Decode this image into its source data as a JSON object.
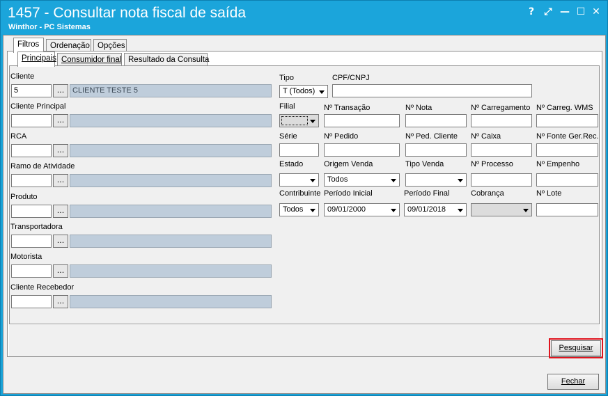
{
  "window": {
    "title": "1457 - Consultar nota fiscal de saída",
    "subtitle": "Winthor - PC Sistemas",
    "controls": [
      "?",
      "⤢",
      "—",
      "☐",
      "✕"
    ]
  },
  "main_tabs": [
    "Filtros",
    "Ordenação",
    "Opções"
  ],
  "sub_tabs": [
    "Principais",
    "Consumidor final",
    "Resultado da Consulta"
  ],
  "left": {
    "cliente": {
      "label": "Cliente",
      "code": "5",
      "name": "CLIENTE TESTE 5"
    },
    "cliente_principal": {
      "label": "Cliente Principal",
      "code": "",
      "name": ""
    },
    "rca": {
      "label": "RCA",
      "code": "",
      "name": ""
    },
    "ramo": {
      "label": "Ramo de Atividade",
      "code": "",
      "name": ""
    },
    "produto": {
      "label": "Produto",
      "code": "",
      "name": ""
    },
    "transportadora": {
      "label": "Transportadora",
      "code": "",
      "name": ""
    },
    "motorista": {
      "label": "Motorista",
      "code": "",
      "name": ""
    },
    "cliente_recebedor": {
      "label": "Cliente Recebedor",
      "code": "",
      "name": ""
    },
    "lookup_button": "..."
  },
  "right": {
    "tipo": {
      "label": "Tipo",
      "value": "T (Todos)"
    },
    "cpf": {
      "label": "CPF/CNPJ",
      "value": ""
    },
    "filial": {
      "label": "Filial",
      "value": ""
    },
    "transacao": {
      "label": "Nº Transação",
      "value": ""
    },
    "nota": {
      "label": "Nº Nota",
      "value": ""
    },
    "carregamento": {
      "label": "Nº Carregamento",
      "value": ""
    },
    "carreg_wms": {
      "label": "Nº Carreg. WMS",
      "value": ""
    },
    "serie": {
      "label": "Série",
      "value": ""
    },
    "pedido": {
      "label": "Nº Pedido",
      "value": ""
    },
    "ped_cliente": {
      "label": "Nº Ped. Cliente",
      "value": ""
    },
    "caixa": {
      "label": "Nº Caixa",
      "value": ""
    },
    "fonte_ger": {
      "label": "Nº Fonte Ger.Rec.",
      "value": ""
    },
    "estado": {
      "label": "Estado",
      "value": ""
    },
    "origem_venda": {
      "label": "Origem Venda",
      "value": "Todos"
    },
    "tipo_venda": {
      "label": "Tipo Venda",
      "value": ""
    },
    "processo": {
      "label": "Nº Processo",
      "value": ""
    },
    "empenho": {
      "label": "Nº Empenho",
      "value": ""
    },
    "contribuinte": {
      "label": "Contribuinte",
      "value": "Todos"
    },
    "periodo_inicial": {
      "label": "Período Inicial",
      "value": "09/01/2000"
    },
    "periodo_final": {
      "label": "Período Final",
      "value": "09/01/2018"
    },
    "cobranca": {
      "label": "Cobrança",
      "value": ""
    },
    "lote": {
      "label": "Nº Lote",
      "value": ""
    }
  },
  "buttons": {
    "pesquisar": {
      "label": "Pesquisar",
      "highlight_color": "#e0141e"
    },
    "fechar": {
      "label": "Fechar"
    }
  }
}
